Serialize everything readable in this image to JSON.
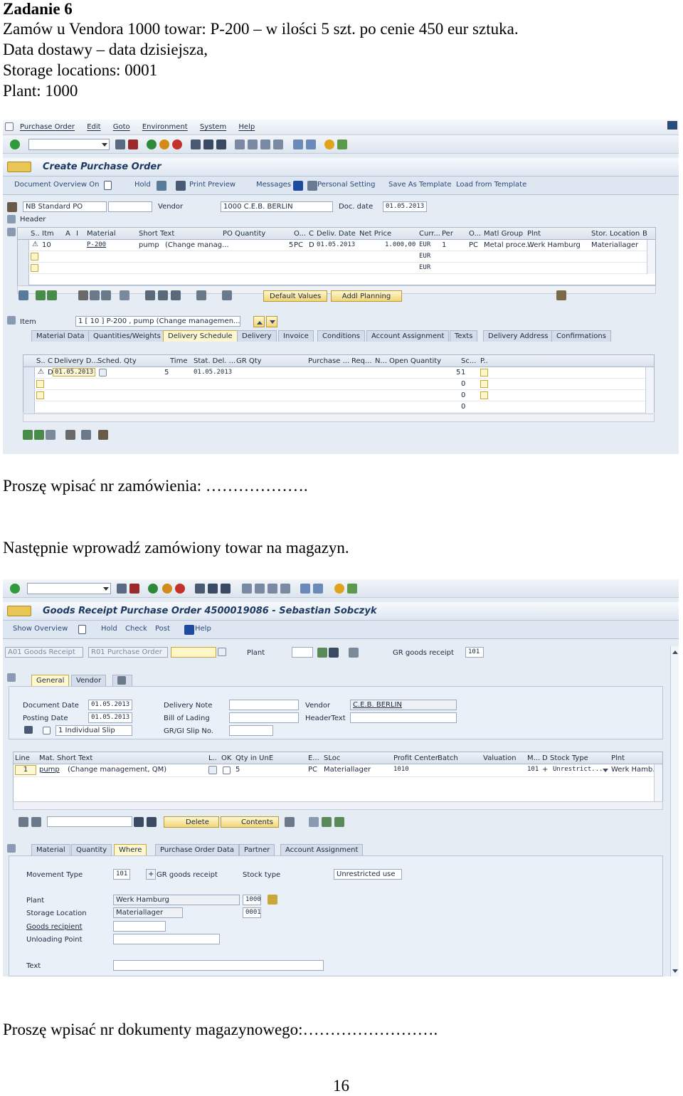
{
  "doc": {
    "heading": "Zadanie 6",
    "line1": "Zamów u Vendora 1000 towar: P-200 – w ilości 5 szt. po cenie 450 eur sztuka.",
    "line2": "Data dostawy – data dzisiejsza,",
    "line3": "Storage locations: 0001",
    "line4": "Plant: 1000",
    "prompt_po": "Proszę wpisać nr zamówienia: ……………….",
    "next_step": "Następnie wprowadź zamówiony towar na magazyn.",
    "prompt_gr": "Proszę wpisać nr dokumenty magazynowego:…………………….",
    "page_number": "16"
  },
  "po": {
    "menu": [
      "Purchase Order",
      "Edit",
      "Goto",
      "Environment",
      "System",
      "Help"
    ],
    "title": "Create Purchase Order",
    "appbar": [
      "Document Overview On",
      "Hold",
      "Print Preview",
      "Messages",
      "Personal Setting",
      "Save As Template",
      "Load from Template"
    ],
    "header": {
      "doc_type": "NB Standard PO",
      "vendor_label": "Vendor",
      "vendor_value": "1000 C.E.B. BERLIN",
      "doc_date_label": "Doc. date",
      "doc_date_value": "01.05.2013",
      "header_label": "Header"
    },
    "items_grid": {
      "columns": [
        "S..",
        "Itm",
        "A",
        "I",
        "Material",
        "Short Text",
        "PO Quantity",
        "O...",
        "C",
        "Deliv. Date",
        "Net Price",
        "Curr...",
        "Per",
        "O...",
        "Matl Group",
        "Plnt",
        "Stor. Location",
        "B"
      ],
      "row1": {
        "itm": "10",
        "material": "P-200",
        "short_text": "pump",
        "change": "(Change manag...",
        "qty": "5",
        "uom": "PC",
        "cat": "D",
        "deliv_date": "01.05.2013",
        "net_price": "1.000,00",
        "curr": "EUR",
        "per": "1",
        "opu": "PC",
        "matl_group": "Metal proce...",
        "plnt": "Werk Hamburg",
        "sloc": "Materiallager"
      },
      "row2_curr": "EUR",
      "row3_curr": "EUR"
    },
    "buttons": {
      "default_values": "Default Values",
      "addl_planning": "Addl Planning"
    },
    "item_bar": {
      "label": "Item",
      "value": "1 [ 10 ] P-200 , pump    (Change managemen..."
    },
    "tabs": [
      "Material Data",
      "Quantities/Weights",
      "Delivery Schedule",
      "Delivery",
      "Invoice",
      "Conditions",
      "Account Assignment",
      "Texts",
      "Delivery Address",
      "Confirmations"
    ],
    "sched_grid": {
      "columns": [
        "S..",
        "C",
        "Delivery D...",
        "Sched. Qty",
        "Time",
        "Stat. Del. ...",
        "GR Qty",
        "Purchase ...",
        "Req...",
        "N...",
        "Open Quantity",
        "Sc...",
        "P.."
      ],
      "row1": {
        "cat": "D",
        "date": "01.05.2013",
        "qty": "5",
        "stat_date": "01.05.2013",
        "open_qty": "5",
        "sc": "1"
      },
      "zeros": [
        "0",
        "0",
        "0"
      ]
    }
  },
  "gr": {
    "title": "Goods Receipt Purchase Order 4500019086 - Sebastian Sobczyk",
    "appbar": [
      "Show Overview",
      "Hold",
      "Check",
      "Post",
      "Help"
    ],
    "selector": {
      "action": "A01 Goods Receipt",
      "ref": "R01 Purchase Order",
      "plant_label": "Plant",
      "gr_label": "GR goods receipt",
      "mvt": "101"
    },
    "header_tabs": [
      "General",
      "Vendor"
    ],
    "general": {
      "doc_date_label": "Document Date",
      "doc_date": "01.05.2013",
      "post_date_label": "Posting Date",
      "post_date": "01.05.2013",
      "slip": "1 Individual Slip",
      "delivery_note_label": "Delivery Note",
      "bol_label": "Bill of Lading",
      "gr_slip_label": "GR/GI Slip No.",
      "vendor_label": "Vendor",
      "vendor_value": "C.E.B. BERLIN",
      "header_text_label": "HeaderText"
    },
    "items_grid": {
      "columns": [
        "Line",
        "Mat. Short Text",
        "L..",
        "OK",
        "Qty in UnE",
        "E...",
        "SLoc",
        "Profit Center",
        "Batch",
        "Valuation",
        "M...",
        "D",
        "Stock Type",
        "Plnt"
      ],
      "row1": {
        "line": "1",
        "text": "pump",
        "change": "(Change management, QM)",
        "qty": "5",
        "uom": "PC",
        "sloc": "Materiallager",
        "profit": "1010",
        "mvt": "101",
        "plus": "+",
        "stock": "Unrestrict...",
        "plnt": "Werk Hamb..."
      }
    },
    "item_buttons": {
      "delete": "Delete",
      "contents": "Contents"
    },
    "detail_tabs": [
      "Material",
      "Quantity",
      "Where",
      "Purchase Order Data",
      "Partner",
      "Account Assignment"
    ],
    "where": {
      "mvt_type_label": "Movement Type",
      "mvt_type": "101",
      "mvt_plus": "+",
      "mvt_text": "GR goods receipt",
      "stock_type_label": "Stock type",
      "stock_type": "Unrestricted use",
      "plant_label": "Plant",
      "plant_name": "Werk Hamburg",
      "plant_code": "1000",
      "sloc_label": "Storage Location",
      "sloc_name": "Materiallager",
      "sloc_code": "0001",
      "recipient_label": "Goods recipient",
      "unloading_label": "Unloading Point",
      "text_label": "Text"
    }
  }
}
